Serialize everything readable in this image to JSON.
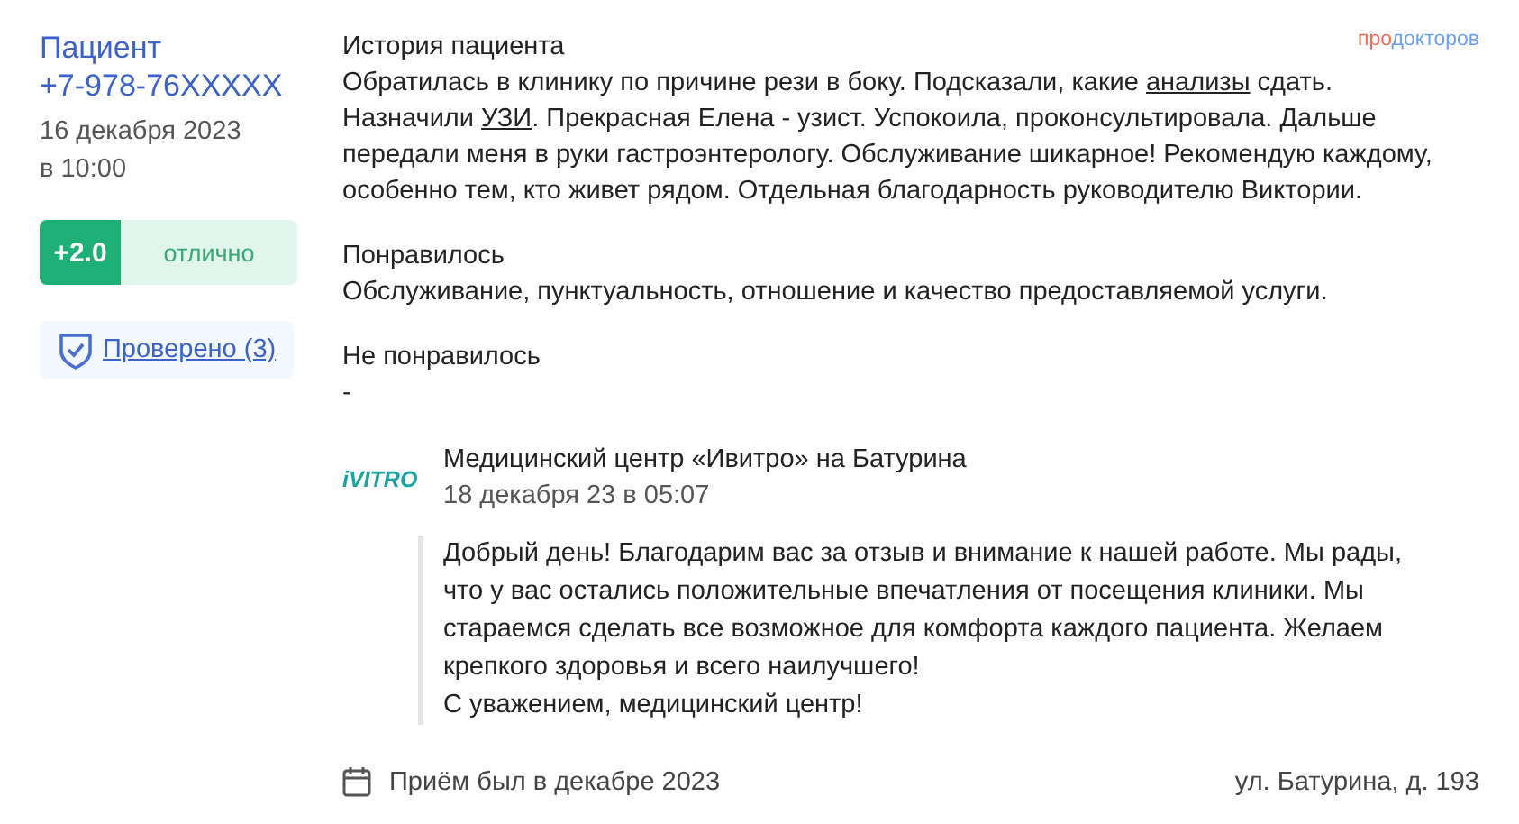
{
  "patient": {
    "name": "Пациент",
    "phone": "+7-978-76XXXXX",
    "date": "16 декабря 2023",
    "time": "в 10:00"
  },
  "rating": {
    "score": "+2.0",
    "label": "отлично"
  },
  "verified": {
    "label": "Проверено (3)"
  },
  "logo": [
    {
      "text": "про",
      "color": "#f26b5b"
    },
    {
      "text": "докторов",
      "color": "#6f9ff0"
    }
  ],
  "story": {
    "title": "История пациента",
    "segments": [
      {
        "text": "Обратилась в клинику по причине рези в боку. Подсказали, какие ",
        "link": false
      },
      {
        "text": "анализы",
        "link": true
      },
      {
        "text": " сдать. Назначили ",
        "link": false
      },
      {
        "text": "УЗИ",
        "link": true
      },
      {
        "text": ". Прекрасная Елена - узист. Успокоила, проконсультировала. Дальше передали меня в руки гастроэнтерологу. Обслуживание шикарное! Рекомендую каждому, особенно тем, кто живет рядом. Отдельная благодарность руководителю Виктории.",
        "link": false
      }
    ]
  },
  "liked": {
    "title": "Понравилось",
    "text": "Обслуживание, пунктуальность, отношение и качество предоставляемой услуги."
  },
  "disliked": {
    "title": "Не понравилось",
    "text": "-"
  },
  "reply": {
    "logo": "iVITRO",
    "clinic": "Медицинский центр «Ивитро» на Батурина",
    "date": "18 декабря 23 в 05:07",
    "lines": [
      "Добрый день! Благодарим вас за отзыв и внимание к нашей работе. Мы рады, что у вас остались положительные впечатления от посещения клиники. Мы стараемся сделать все возможное для комфорта каждого пациента. Желаем крепкого здоровья и всего наилучшего!",
      "С уважением, медицинский центр!"
    ]
  },
  "footer": {
    "visit": "Приём был в декабре 2023",
    "address": "ул. Батурина, д. 193"
  }
}
